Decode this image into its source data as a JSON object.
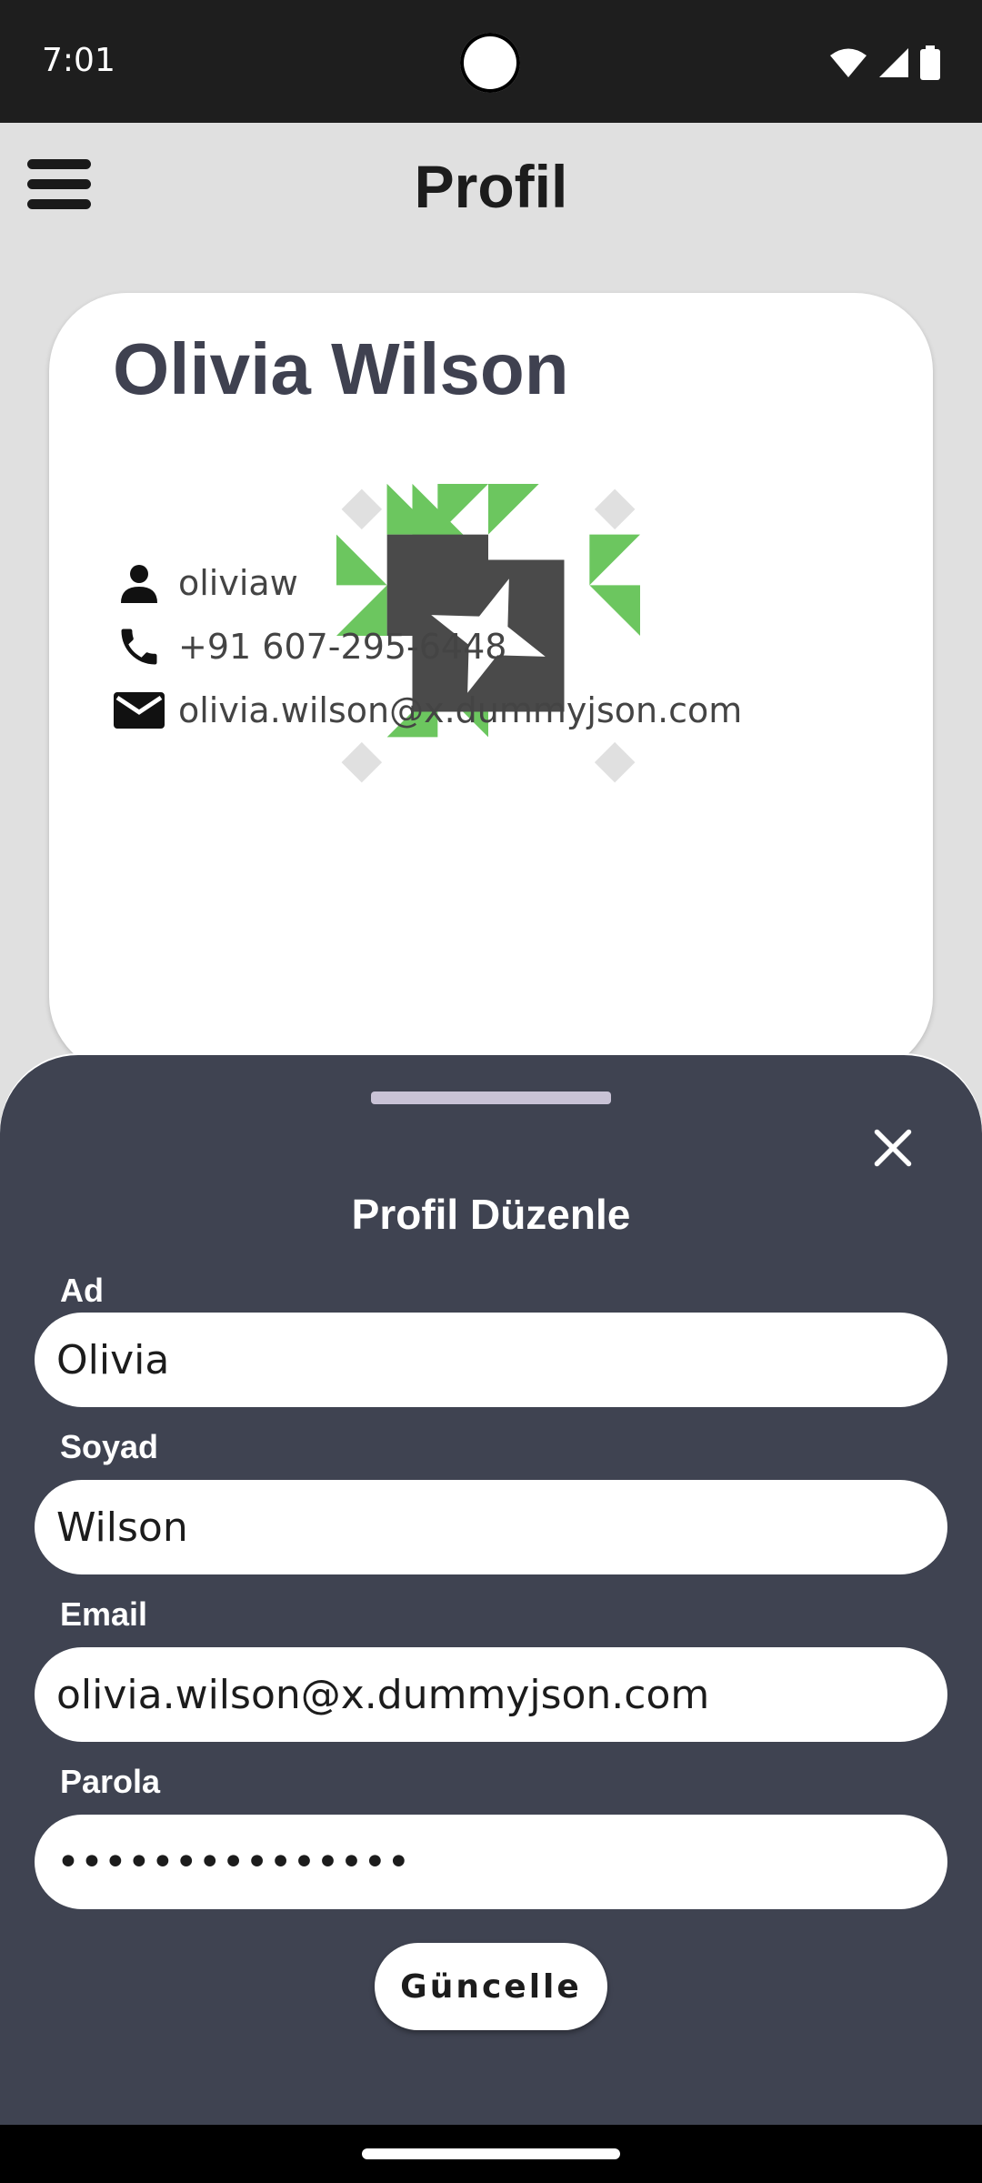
{
  "status_bar": {
    "time": "7:01",
    "icons": [
      "wifi-icon",
      "signal-icon",
      "battery-icon"
    ]
  },
  "app_bar": {
    "title": "Profil",
    "menu_icon": "menu-icon"
  },
  "profile": {
    "name": "Olivia Wilson",
    "username": "oliviaw",
    "phone": "+91 607-295-6448",
    "email": "olivia.wilson@x.dummyjson.com",
    "avatar_colors": {
      "accent": "#6cc65f",
      "dark": "#4a4a4a",
      "light": "#e0e0e0"
    }
  },
  "edit_sheet": {
    "title": "Profil Düzenle",
    "first_name": {
      "label": "Ad",
      "value": "Olivia"
    },
    "last_name": {
      "label": "Soyad",
      "value": "Wilson"
    },
    "email": {
      "label": "Email",
      "value": "olivia.wilson@x.dummyjson.com"
    },
    "password": {
      "label": "Parola",
      "value": "•••••••••••••••"
    },
    "submit_label": "Güncelle"
  }
}
